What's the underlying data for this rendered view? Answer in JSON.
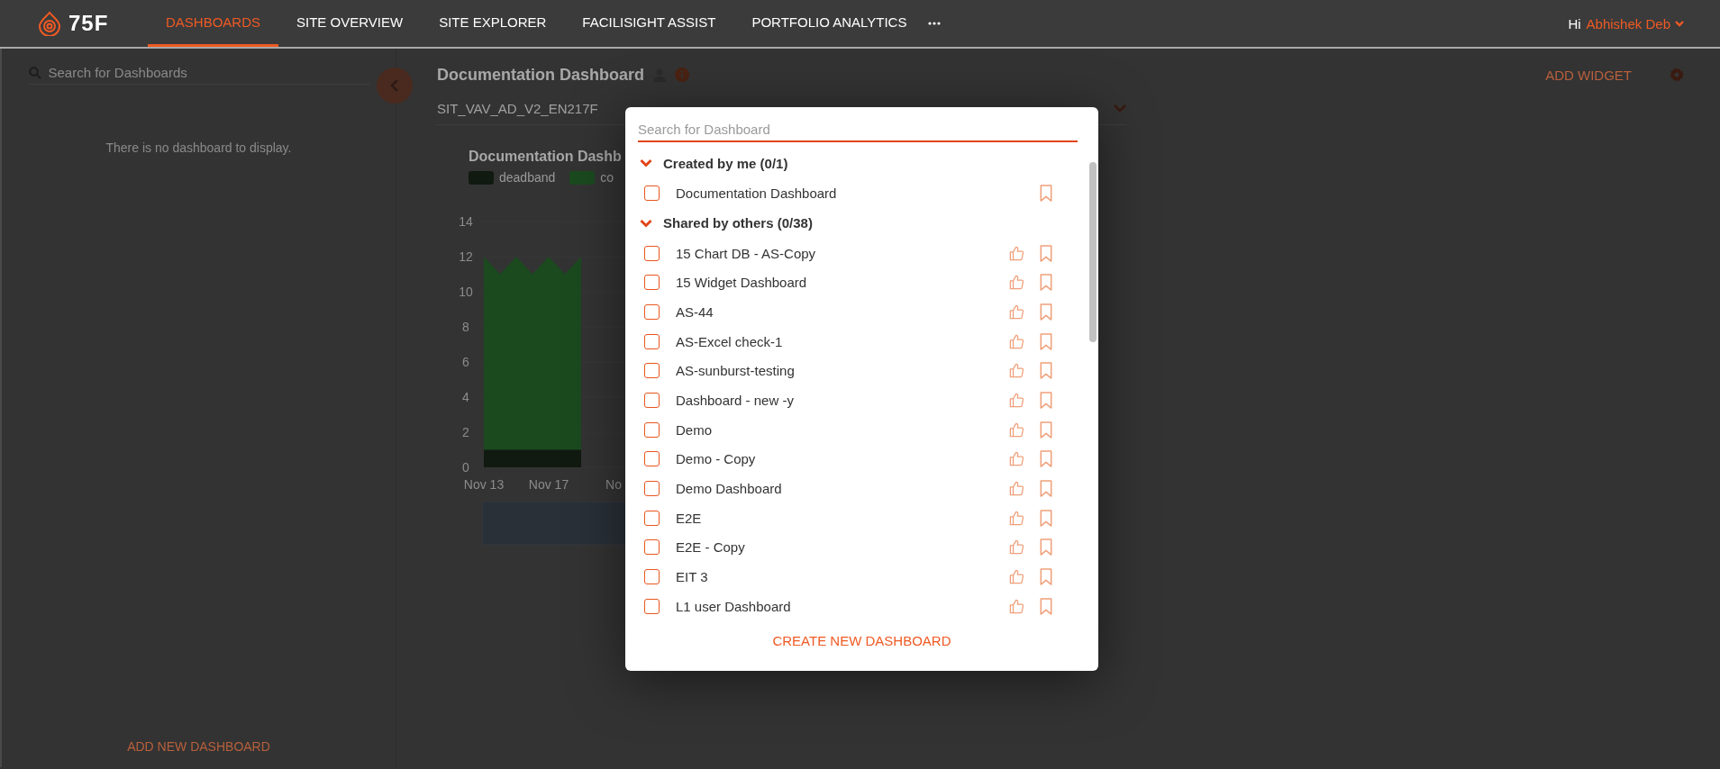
{
  "nav": {
    "logo": "75F",
    "tabs": [
      {
        "label": "DASHBOARDS",
        "selected": true
      },
      {
        "label": "SITE OVERVIEW",
        "selected": false
      },
      {
        "label": "SITE EXPLORER",
        "selected": false
      },
      {
        "label": "FACILISIGHT ASSIST",
        "selected": false
      },
      {
        "label": "PORTFOLIO ANALYTICS",
        "selected": false
      }
    ],
    "greeting": "Hi",
    "user": "Abhishek Deb"
  },
  "sidebar": {
    "search": {
      "placeholder": "Search for Dashboards"
    },
    "empty_message": "There is no dashboard to display.",
    "add_button": "ADD NEW DASHBOARD"
  },
  "main": {
    "title": "Documentation Dashboard",
    "add_widget": "ADD WIDGET",
    "selector": {
      "value": "SIT_VAV_AD_V2_EN217F"
    },
    "widget": {
      "title": "Documentation Dashb",
      "chart_data": {
        "type": "area",
        "categories": [
          "Nov 13",
          null,
          null,
          null,
          "Nov 17",
          null,
          null,
          null,
          "No"
        ],
        "series": [
          {
            "name": "deadband",
            "color": "#101a10",
            "values": [
              1,
              1,
              1,
              1,
              1,
              1,
              1,
              null,
              null
            ]
          },
          {
            "name": "co",
            "color": "#1b4a1f",
            "values": [
              12,
              11,
              12,
              11,
              12,
              11,
              12,
              null,
              null
            ]
          }
        ],
        "ylim": [
          0,
          14
        ],
        "yticks": [
          0,
          2,
          4,
          6,
          8,
          10,
          12,
          14
        ]
      }
    }
  },
  "modal": {
    "search": {
      "placeholder": "Search for Dashboard"
    },
    "sections": [
      {
        "kind": "created",
        "title": "Created by me (0/1)",
        "expanded": true,
        "items": [
          {
            "name": "Documentation Dashboard",
            "checked": false
          }
        ]
      },
      {
        "kind": "shared",
        "title": "Shared by others (0/38)",
        "expanded": true,
        "items": [
          {
            "name": "15 Chart DB - AS-Copy",
            "checked": false
          },
          {
            "name": "15 Widget Dashboard",
            "checked": false
          },
          {
            "name": "AS-44",
            "checked": false
          },
          {
            "name": "AS-Excel check-1",
            "checked": false
          },
          {
            "name": "AS-sunburst-testing",
            "checked": false
          },
          {
            "name": "Dashboard - new -y",
            "checked": false
          },
          {
            "name": "Demo",
            "checked": false
          },
          {
            "name": "Demo - Copy",
            "checked": false
          },
          {
            "name": "Demo Dashboard",
            "checked": false
          },
          {
            "name": "E2E",
            "checked": false
          },
          {
            "name": "E2E - Copy",
            "checked": false
          },
          {
            "name": "EIT 3",
            "checked": false
          },
          {
            "name": "L1 user Dashboard",
            "checked": false
          }
        ]
      }
    ],
    "create_button": "CREATE NEW DASHBOARD"
  }
}
